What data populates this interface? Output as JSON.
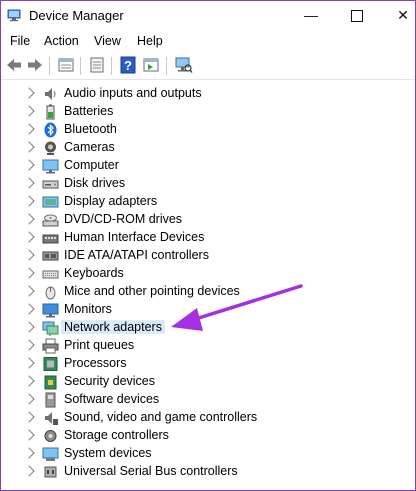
{
  "window": {
    "title": "Device Manager",
    "minimize_glyph": "—",
    "close_glyph": "✕"
  },
  "menu": {
    "file": "File",
    "action": "Action",
    "view": "View",
    "help": "Help"
  },
  "toolbar": {
    "icons": [
      "back-arrow-icon",
      "forward-arrow-icon",
      "properties-icon",
      "update-driver-icon",
      "help-icon",
      "show-hidden-icon",
      "scan-hardware-icon"
    ]
  },
  "tree": {
    "items": [
      {
        "label": "Audio inputs and outputs",
        "icon": "speaker-icon"
      },
      {
        "label": "Batteries",
        "icon": "battery-icon"
      },
      {
        "label": "Bluetooth",
        "icon": "bluetooth-icon"
      },
      {
        "label": "Cameras",
        "icon": "camera-icon"
      },
      {
        "label": "Computer",
        "icon": "computer-icon"
      },
      {
        "label": "Disk drives",
        "icon": "disk-drive-icon"
      },
      {
        "label": "Display adapters",
        "icon": "display-adapter-icon"
      },
      {
        "label": "DVD/CD-ROM drives",
        "icon": "dvd-drive-icon"
      },
      {
        "label": "Human Interface Devices",
        "icon": "hid-icon"
      },
      {
        "label": "IDE ATA/ATAPI controllers",
        "icon": "ide-controller-icon"
      },
      {
        "label": "Keyboards",
        "icon": "keyboard-icon"
      },
      {
        "label": "Mice and other pointing devices",
        "icon": "mouse-icon"
      },
      {
        "label": "Monitors",
        "icon": "monitor-icon"
      },
      {
        "label": "Network adapters",
        "icon": "network-adapter-icon",
        "selected": true
      },
      {
        "label": "Print queues",
        "icon": "printer-icon"
      },
      {
        "label": "Processors",
        "icon": "processor-icon"
      },
      {
        "label": "Security devices",
        "icon": "security-device-icon"
      },
      {
        "label": "Software devices",
        "icon": "software-device-icon"
      },
      {
        "label": "Sound, video and game controllers",
        "icon": "sound-controller-icon"
      },
      {
        "label": "Storage controllers",
        "icon": "storage-controller-icon"
      },
      {
        "label": "System devices",
        "icon": "system-device-icon"
      },
      {
        "label": "Universal Serial Bus controllers",
        "icon": "usb-icon"
      }
    ]
  },
  "colors": {
    "arrow": "#a430e0",
    "selection": "#d9ebfa",
    "border": "#8a3fb5"
  }
}
